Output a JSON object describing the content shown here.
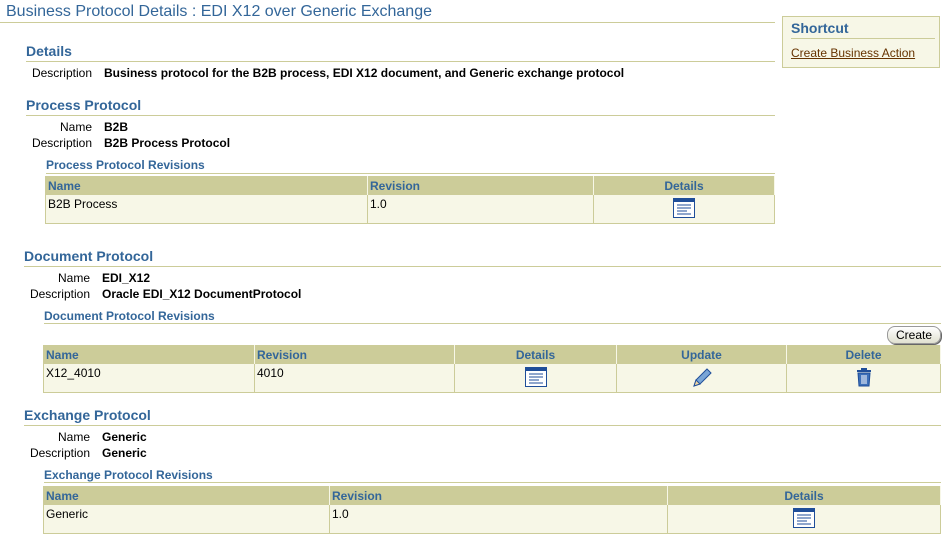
{
  "page_title": "Business Protocol Details : EDI X12 over Generic Exchange",
  "shortcut": {
    "heading": "Shortcut",
    "link": "Create Business Action"
  },
  "details": {
    "heading": "Details",
    "description_label": "Description",
    "description": "Business protocol for the B2B process, EDI X12 document, and Generic exchange protocol"
  },
  "process_protocol": {
    "heading": "Process Protocol",
    "name_label": "Name",
    "name": "B2B",
    "description_label": "Description",
    "description": "B2B Process Protocol",
    "revisions_heading": "Process Protocol Revisions",
    "columns": [
      "Name",
      "Revision",
      "Details"
    ],
    "rows": [
      {
        "name": "B2B Process",
        "revision": "1.0"
      }
    ]
  },
  "document_protocol": {
    "heading": "Document Protocol",
    "name_label": "Name",
    "name": "EDI_X12",
    "description_label": "Description",
    "description": "Oracle EDI_X12 DocumentProtocol",
    "revisions_heading": "Document Protocol Revisions",
    "create_button": "Create",
    "columns": [
      "Name",
      "Revision",
      "Details",
      "Update",
      "Delete"
    ],
    "rows": [
      {
        "name": "X12_4010",
        "revision": "4010"
      }
    ]
  },
  "exchange_protocol": {
    "heading": "Exchange Protocol",
    "name_label": "Name",
    "name": "Generic",
    "description_label": "Description",
    "description": "Generic",
    "revisions_heading": "Exchange Protocol Revisions",
    "columns": [
      "Name",
      "Revision",
      "Details"
    ],
    "rows": [
      {
        "name": "Generic",
        "revision": "1.0"
      }
    ]
  },
  "icons": {
    "details": "details-icon",
    "update": "pencil-icon",
    "delete": "trash-icon"
  },
  "colors": {
    "heading": "#336699",
    "table_header_bg": "#cccc99",
    "table_row_bg": "#f7f7e7",
    "link": "#663300"
  }
}
